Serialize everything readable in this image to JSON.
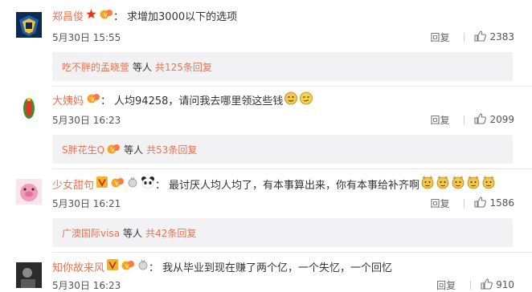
{
  "colors": {
    "accent": "#eb7350",
    "text": "#333333",
    "subbox_bg": "#f2f2f5"
  },
  "icons": {
    "reply": "reply-text",
    "like": "thumbs-up-icon",
    "vip": "vip-v-icon",
    "fan": "fan-badge-icon",
    "emoji": "doge-emoji-icon"
  },
  "comments": [
    {
      "user": "郑昌俊",
      "text": "求增加3000以下的选项",
      "time": "5月30日 15:55",
      "reply_label": "回复",
      "likes": "2383",
      "sub": {
        "user": "吃不胖的孟晓萱",
        "mid": "等人",
        "total": "共125条回复"
      }
    },
    {
      "user": "大姨妈",
      "text": "人均94258，请问我去哪里领这些钱",
      "time": "5月30日 16:23",
      "reply_label": "回复",
      "likes": "2099",
      "sub": {
        "user": "S胖花生Q",
        "mid": "等人",
        "total": "共53条回复"
      }
    },
    {
      "user": "少女甜句",
      "text": "最讨厌人均人均了，有本事算出来，你有本事给补齐啊",
      "time": "5月30日 16:21",
      "reply_label": "回复",
      "likes": "1586",
      "sub": {
        "user": "广澳国际visa",
        "mid": "等人",
        "total": "共42条回复"
      }
    },
    {
      "user": "知你故来风",
      "text": "我从毕业到现在赚了两个亿，一个失忆，一个回忆",
      "time": "5月30日 16:23",
      "reply_label": "回复",
      "likes": "910"
    }
  ]
}
